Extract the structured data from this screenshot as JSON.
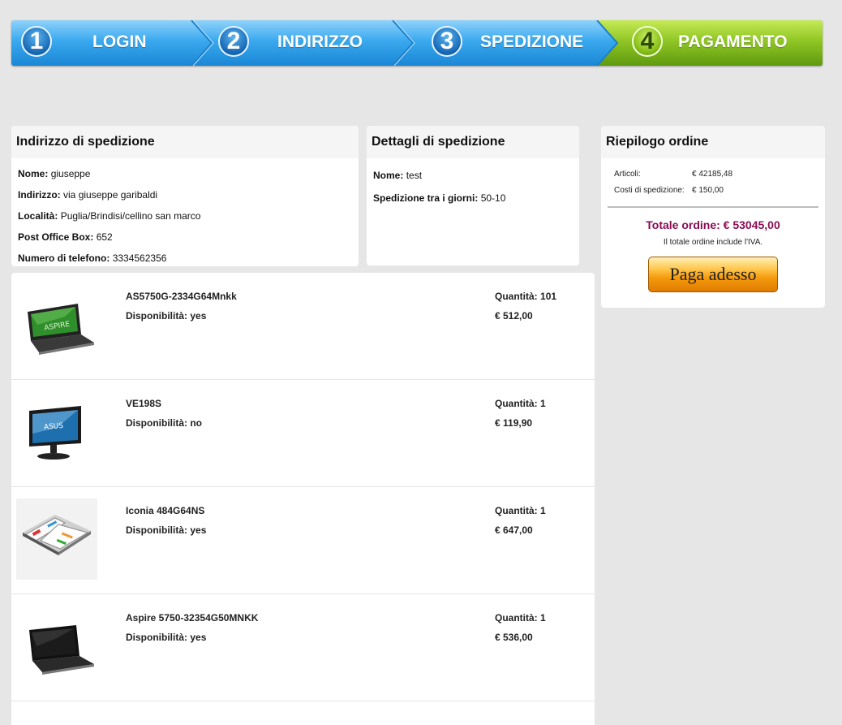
{
  "steps": [
    {
      "number": "1",
      "label": "LOGIN"
    },
    {
      "number": "2",
      "label": "INDIRIZZO"
    },
    {
      "number": "3",
      "label": "SPEDIZIONE"
    },
    {
      "number": "4",
      "label": "PAGAMENTO"
    }
  ],
  "colors": {
    "step_blue": "#2da0ea",
    "step_active_green": "#8bc21b",
    "total_color": "#8a0b52"
  },
  "shipping_address": {
    "title": "Indirizzo di spedizione",
    "name_label": "Nome:",
    "name": "giuseppe",
    "address_label": "Indirizzo:",
    "address": "via giuseppe garibaldi",
    "city_label": "Località:",
    "city": "Puglia/Brindisi/cellino san marco",
    "pobox_label": "Post Office Box:",
    "pobox": "652",
    "phone_label": "Numero di telefono:",
    "phone": "3334562356"
  },
  "shipping_details": {
    "title": "Dettagli di spedizione",
    "name_label": "Nome:",
    "name": "test",
    "days_label": "Spedizione tra i giorni:",
    "days": "50-10"
  },
  "summary": {
    "title": "Riepilogo ordine",
    "items_label": "Articoli:",
    "items_value": "€ 42185,48",
    "shipping_label": "Costi di spedizione:",
    "shipping_value": "€ 150,00",
    "total": "Totale ordine: € 53045,00",
    "vat_note": "Il totale ordine include l'IVA.",
    "pay_button": "Paga adesso"
  },
  "products": [
    {
      "name": "AS5750G-2334G64Mnkk",
      "avail_label": "Disponibilità:",
      "avail": "yes",
      "qty_label": "Quantità:",
      "qty": "101",
      "price": "€ 512,00",
      "image": "laptop-green-icon"
    },
    {
      "name": "VE198S",
      "avail_label": "Disponibilità:",
      "avail": "no",
      "qty_label": "Quantità:",
      "qty": "1",
      "price": "€ 119,90",
      "image": "monitor-icon"
    },
    {
      "name": "Iconia 484G64NS",
      "avail_label": "Disponibilità:",
      "avail": "yes",
      "qty_label": "Quantità:",
      "qty": "1",
      "price": "€ 647,00",
      "image": "dual-screen-tablet-icon"
    },
    {
      "name": "Aspire 5750-32354G50MNKK",
      "avail_label": "Disponibilità:",
      "avail": "yes",
      "qty_label": "Quantità:",
      "qty": "1",
      "price": "€ 536,00",
      "image": "laptop-black-icon"
    }
  ]
}
